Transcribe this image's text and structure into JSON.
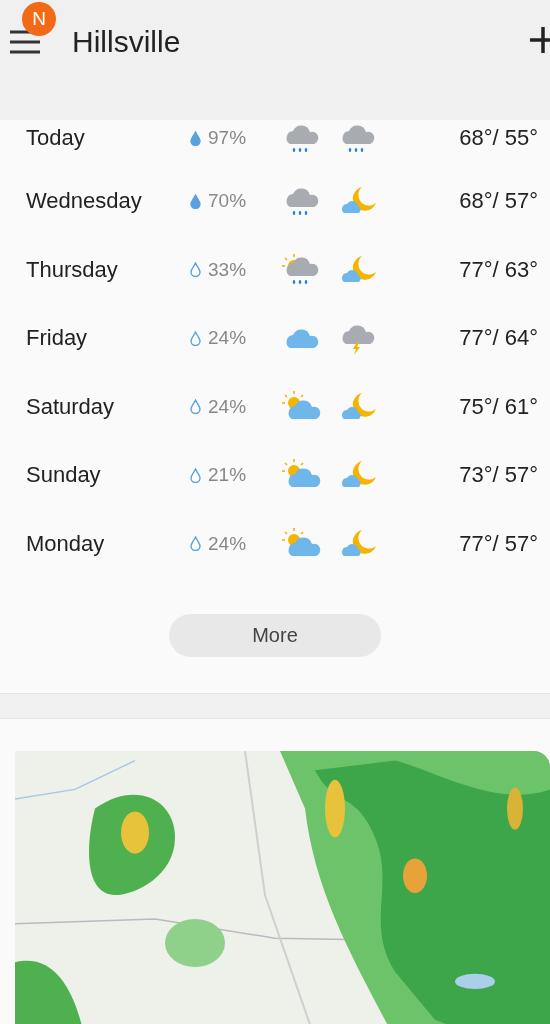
{
  "header": {
    "badge": "N",
    "title": "Hillsville"
  },
  "forecast": [
    {
      "day": "Today",
      "drop_filled": true,
      "precip": "97%",
      "day_icon": {
        "kind": "rain"
      },
      "night_icon": {
        "kind": "rain"
      },
      "temps": "68°/ 55°"
    },
    {
      "day": "Wednesday",
      "drop_filled": true,
      "precip": "70%",
      "day_icon": {
        "kind": "rain"
      },
      "night_icon": {
        "kind": "moon"
      },
      "temps": "68°/ 57°"
    },
    {
      "day": "Thursday",
      "drop_filled": false,
      "precip": "33%",
      "day_icon": {
        "kind": "sunrain"
      },
      "night_icon": {
        "kind": "moon"
      },
      "temps": "77°/ 63°"
    },
    {
      "day": "Friday",
      "drop_filled": false,
      "precip": "24%",
      "day_icon": {
        "kind": "cloud"
      },
      "night_icon": {
        "kind": "thunder"
      },
      "temps": "77°/ 64°"
    },
    {
      "day": "Saturday",
      "drop_filled": false,
      "precip": "24%",
      "day_icon": {
        "kind": "sunny"
      },
      "night_icon": {
        "kind": "moon"
      },
      "temps": "75°/ 61°"
    },
    {
      "day": "Sunday",
      "drop_filled": false,
      "precip": "21%",
      "day_icon": {
        "kind": "sunny"
      },
      "night_icon": {
        "kind": "moon"
      },
      "temps": "73°/ 57°"
    },
    {
      "day": "Monday",
      "drop_filled": false,
      "precip": "24%",
      "day_icon": {
        "kind": "sunny"
      },
      "night_icon": {
        "kind": "moon"
      },
      "temps": "77°/ 57°"
    }
  ],
  "more_button": "More"
}
